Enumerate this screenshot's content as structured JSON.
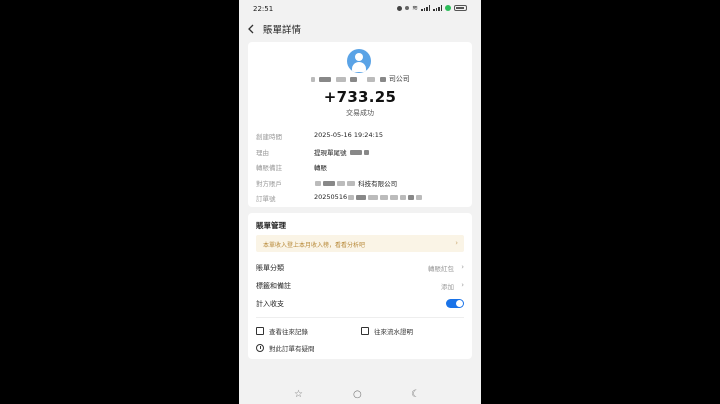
{
  "status": {
    "time": "22:51",
    "battery_label": ""
  },
  "header": {
    "title": "賬單詳情"
  },
  "summary": {
    "payee_suffix": "司",
    "payee_pre": "司公",
    "amount": "+733.25",
    "state": "交易成功"
  },
  "details": [
    {
      "label": "創建時間",
      "value": "2025-05-16 19:24:15"
    },
    {
      "label": "理由",
      "value": "提現單尾號"
    },
    {
      "label": "轉賬備註",
      "value": "轉賬"
    },
    {
      "label": "對方賬戶",
      "value": "科技有限公司"
    },
    {
      "label": "訂單號",
      "value": "20250516"
    }
  ],
  "management": {
    "title": "賬單管理",
    "banner": "本單收入登上本月收入榜，看看分析吧",
    "category_label": "賬單分類",
    "category_value": "轉賬紅包",
    "tags_label": "標籤和備註",
    "tags_value": "添加",
    "include_label": "計入收支",
    "include_on": true,
    "links": {
      "records": "查看往來記錄",
      "statement": "往來流水證明",
      "question": "對此訂單有疑問"
    }
  },
  "colors": {
    "accent": "#1a73e8",
    "avatar": "#5aa3e6",
    "banner_text": "#b88a3a"
  }
}
